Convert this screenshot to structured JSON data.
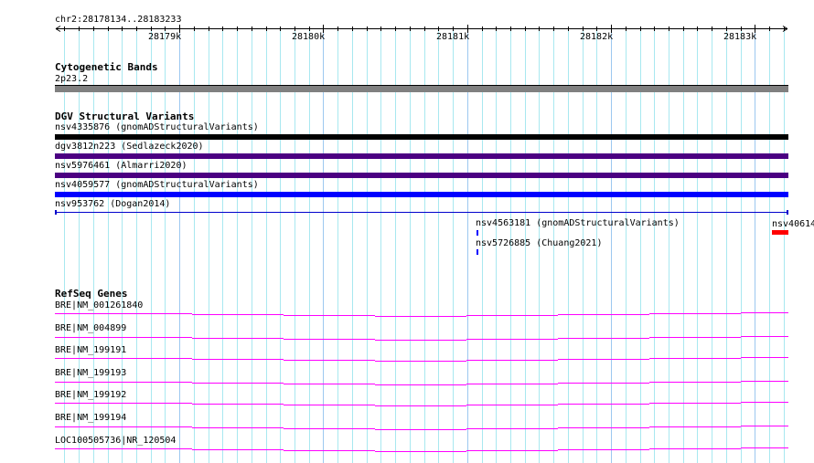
{
  "ruler": {
    "region": "chr2:28178134..28183233",
    "start": 28178134,
    "end": 28183233,
    "ticks": [
      "28179k",
      "28180k",
      "28181k",
      "28182k",
      "28183k"
    ]
  },
  "tracks": {
    "cytobands": {
      "title": "Cytogenetic Bands",
      "band": "2p23.2"
    },
    "dgv": {
      "title": "DGV Structural Variants",
      "items": [
        {
          "label": "nsv4335876 (gnomADStructuralVariants)",
          "color": "#000000"
        },
        {
          "label": "dgv3812n223 (Sedlazeck2020)",
          "color": "#4b0082"
        },
        {
          "label": "nsv5976461 (Almarri2020)",
          "color": "#4b0082"
        },
        {
          "label": "nsv4059577 (gnomADStructuralVariants)",
          "color": "#0000ff"
        },
        {
          "label": "nsv953762 (Dogan2014)",
          "color": "#0000cc"
        },
        {
          "label": "nsv4563181 (gnomADStructuralVariants)",
          "color": "#0000ff"
        },
        {
          "label": "nsv5726885 (Chuang2021)",
          "color": "#0000ff"
        },
        {
          "label": "nsv40614",
          "color": "#ff0000"
        }
      ]
    },
    "refseq": {
      "title": "RefSeq Genes",
      "color": "#ff00ff",
      "items": [
        "BRE|NM_001261840",
        "BRE|NM_004899",
        "BRE|NM_199191",
        "BRE|NM_199193",
        "BRE|NM_199192",
        "BRE|NM_199194",
        "LOC100505736|NR_120504"
      ]
    }
  }
}
